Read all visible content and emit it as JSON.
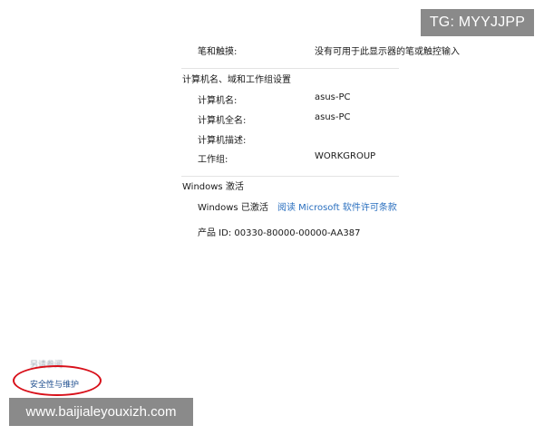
{
  "watermarks": {
    "top": "TG: MYYJJPP",
    "bottom": "www.baijialeyouxizh.com"
  },
  "system": {
    "pen_touch_label": "笔和触摸:",
    "pen_touch_value": "没有可用于此显示器的笔或触控输入"
  },
  "computer_section": {
    "title": "计算机名、域和工作组设置",
    "rows": [
      {
        "label": "计算机名:",
        "value": "asus-PC"
      },
      {
        "label": "计算机全名:",
        "value": "asus-PC"
      },
      {
        "label": "计算机描述:",
        "value": ""
      },
      {
        "label": "工作组:",
        "value": "WORKGROUP"
      }
    ]
  },
  "activation": {
    "title": "Windows 激活",
    "status": "Windows 已激活",
    "license_link": "阅读 Microsoft 软件许可条款",
    "product_id": "产品 ID: 00330-80000-00000-AA387"
  },
  "see_also": {
    "heading": "另请参阅",
    "security_link": "安全性与维护"
  },
  "colors": {
    "link": "#2a6fbf",
    "highlight_circle": "#d8101a"
  }
}
